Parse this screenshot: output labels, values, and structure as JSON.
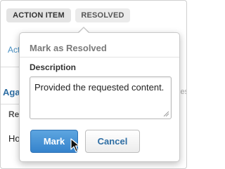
{
  "tags": {
    "action_item": "ACTION ITEM",
    "resolved": "RESOLVED"
  },
  "background": {
    "link_fragment": "Act",
    "tab_fragment": "Aga",
    "heading_fragment": "Re",
    "text_fragment": "Ho",
    "right_fragment": "les"
  },
  "popover": {
    "title": "Mark as Resolved",
    "description_label": "Description",
    "description_value": "Provided the requested content.",
    "mark_button": "Mark",
    "cancel_button": "Cancel"
  },
  "colors": {
    "accent": "#3583cc",
    "link": "#2d6da3"
  }
}
